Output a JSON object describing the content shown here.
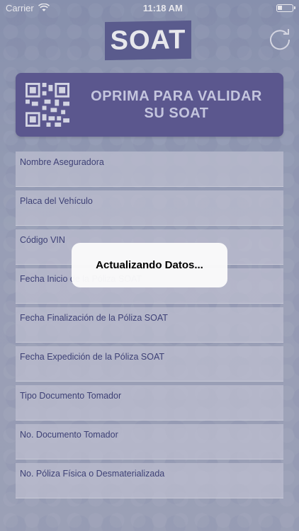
{
  "status_bar": {
    "carrier": "Carrier",
    "time": "11:18 AM",
    "wifi_icon": "wifi-icon",
    "battery_icon": "battery-icon"
  },
  "header": {
    "logo_text": "SOAT",
    "refresh_icon": "refresh-icon"
  },
  "validate_button": {
    "label_line1": "OPRIMA PARA VALIDAR",
    "label_line2": "SU SOAT",
    "icon": "qr-code-icon"
  },
  "fields": [
    {
      "label": "Nombre Aseguradora"
    },
    {
      "label": "Placa del Vehículo"
    },
    {
      "label": "Código VIN"
    },
    {
      "label": "Fecha Inicio de la Póliza SOAT"
    },
    {
      "label": "Fecha Finalización de la Póliza SOAT"
    },
    {
      "label": "Fecha Expedición de la Póliza SOAT"
    },
    {
      "label": "Tipo Documento Tomador"
    },
    {
      "label": "No. Documento Tomador"
    },
    {
      "label": "No. Póliza Física o Desmaterializada"
    }
  ],
  "alert": {
    "message": "Actualizando Datos..."
  },
  "colors": {
    "brand": "#54558b",
    "button": "#55508d",
    "field_text": "#30346e"
  }
}
